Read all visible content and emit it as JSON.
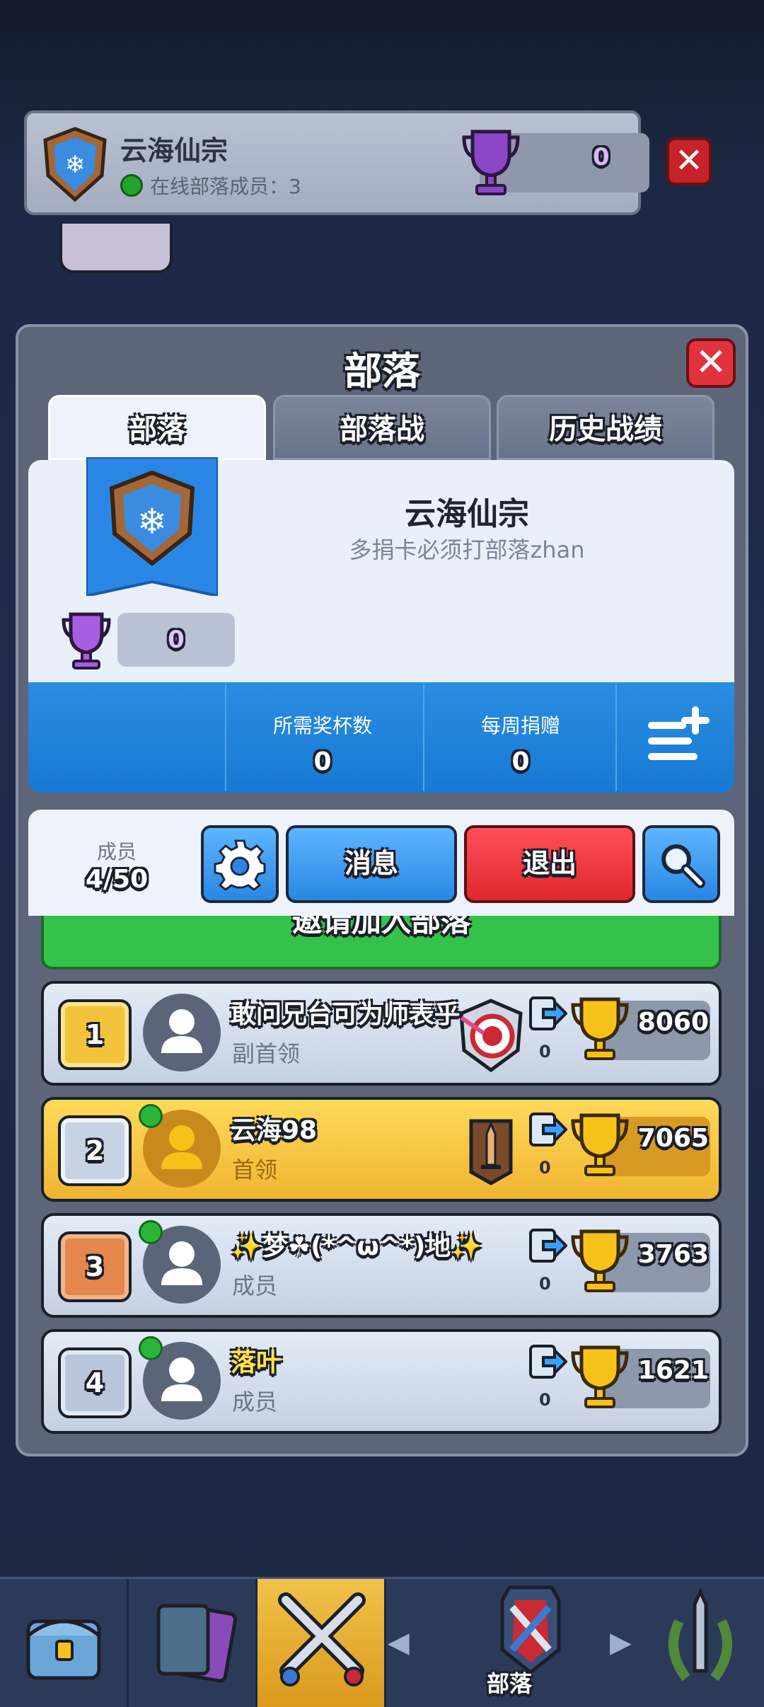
{
  "background_bar": {
    "clan_name": "云海仙宗",
    "online_label": "在线部落成员：3",
    "trophies": "0"
  },
  "panel": {
    "title": "部落",
    "tabs": [
      {
        "label": "部落",
        "active": true
      },
      {
        "label": "部落战",
        "active": false
      },
      {
        "label": "历史战绩",
        "active": false
      }
    ]
  },
  "clan": {
    "name": "云海仙宗",
    "description": "多捐卡必须打部落zhan",
    "trophies": "0",
    "required_trophies_label": "所需奖杯数",
    "required_trophies": "0",
    "weekly_donations_label": "每周捐赠",
    "weekly_donations": "0"
  },
  "toolbar": {
    "members_label": "成员",
    "members_count": "4/50",
    "message_label": "消息",
    "leave_label": "退出"
  },
  "invite_label": "邀请加入部落",
  "members": [
    {
      "rank": "1",
      "name": "敢问兄台可为师表乎",
      "role": "副首领",
      "donations": "0",
      "trophies": "8060",
      "online": false
    },
    {
      "rank": "2",
      "name": "云海98",
      "role": "首领",
      "donations": "0",
      "trophies": "7065",
      "online": true
    },
    {
      "rank": "3",
      "name": "✨梦☘(*^ω^*)地✨",
      "role": "成员",
      "donations": "0",
      "trophies": "3763",
      "online": true
    },
    {
      "rank": "4",
      "name": "落叶",
      "role": "成员",
      "donations": "0",
      "trophies": "1621",
      "online": true
    }
  ],
  "nav": {
    "clan_label": "部落",
    "items": [
      "shop-icon",
      "cards-icon",
      "battle-icon",
      "clan-icon",
      "events-icon"
    ]
  },
  "colors": {
    "accent_blue": "#2a86e4",
    "danger_red": "#e0262f",
    "leader_gold": "#f0b531",
    "online_green": "#2ab53a"
  }
}
